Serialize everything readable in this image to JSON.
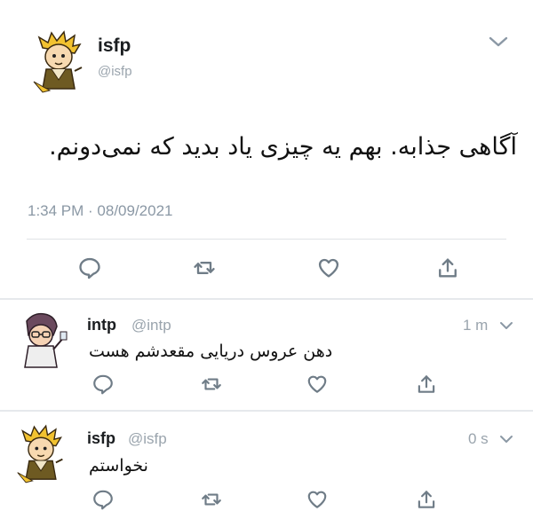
{
  "main_tweet": {
    "name": "isfp",
    "handle": "@isfp",
    "text": "آگاهی جذابه. بهم یه چیزی یاد بدید که نمی‌دونم.",
    "timestamp": "1:34 PM · 08/09/2021",
    "avatar_icon": "cartoon-avatar-icon",
    "menu_icon": "chevron-down-icon"
  },
  "replies": [
    {
      "name": "intp",
      "handle": "@intp",
      "time": "1 m",
      "text": "دهن عروس دریایی مقعدشم هست",
      "avatar_icon": "cartoon-avatar-icon"
    },
    {
      "name": "isfp",
      "handle": "@isfp",
      "time": "0 s",
      "text": "نخواستم",
      "avatar_icon": "cartoon-avatar-icon"
    }
  ],
  "actions": [
    "reply-icon",
    "retweet-icon",
    "like-icon",
    "share-icon"
  ],
  "colors": {
    "icon": "#7a8691",
    "text": "#14171a",
    "muted": "#8b98a5",
    "divider": "#e6e9ec"
  }
}
